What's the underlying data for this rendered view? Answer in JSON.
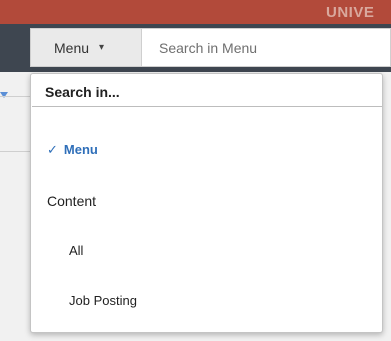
{
  "banner": {
    "text": "UNIVE"
  },
  "header": {
    "menu_button_label": "Menu",
    "menu_caret": "▾",
    "search_placeholder": "Search in Menu"
  },
  "dropdown": {
    "header": "Search in...",
    "items": [
      {
        "label": "Menu",
        "selected": true,
        "check": "✓"
      }
    ],
    "group_label": "Content",
    "group_items": [
      {
        "label": "All"
      },
      {
        "label": "Job Posting"
      }
    ]
  },
  "colors": {
    "banner": "#b24a3a",
    "header_bar": "#3e4650",
    "selected_item": "#2f6fb9"
  }
}
